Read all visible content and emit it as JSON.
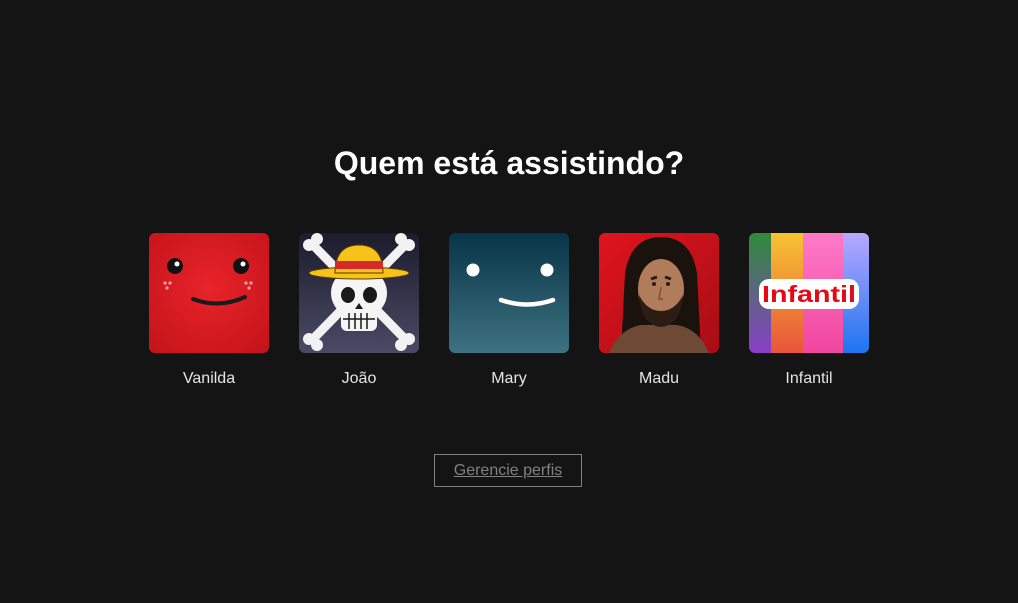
{
  "heading": "Quem está assistindo?",
  "profiles": [
    {
      "name": "Vanilda",
      "avatar_icon": "red-smiley-avatar-icon"
    },
    {
      "name": "João",
      "avatar_icon": "straw-hat-skull-avatar-icon"
    },
    {
      "name": "Mary",
      "avatar_icon": "teal-smiley-avatar-icon"
    },
    {
      "name": "Madu",
      "avatar_icon": "wrestler-photo-avatar"
    },
    {
      "name": "Infantil",
      "avatar_icon": "kids-rainbow-avatar-icon",
      "avatar_text": "Infantil"
    }
  ],
  "manage_button": "Gerencie perfis",
  "colors": {
    "background": "#141414",
    "text": "#ffffff",
    "muted": "#808080"
  }
}
